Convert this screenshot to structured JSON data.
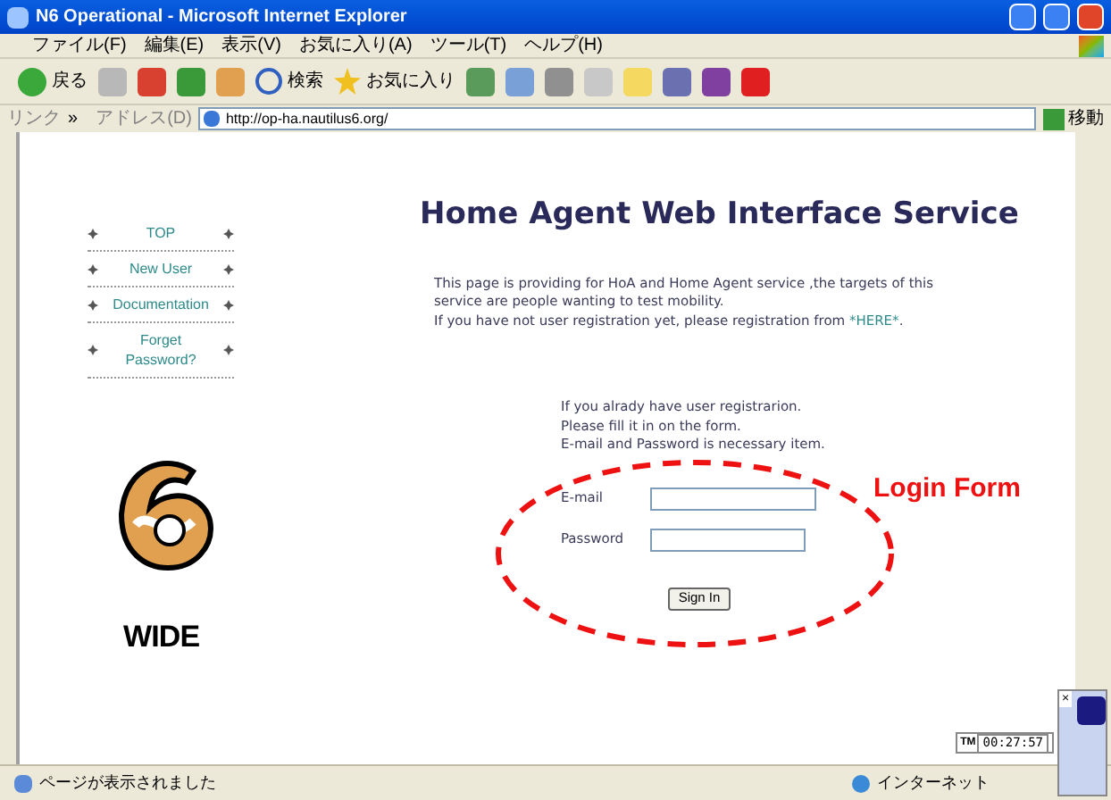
{
  "window": {
    "title": "N6 Operational - Microsoft Internet Explorer"
  },
  "menu": [
    "ファイル(F)",
    "編集(E)",
    "表示(V)",
    "お気に入り(A)",
    "ツール(T)",
    "ヘルプ(H)"
  ],
  "toolbar": {
    "back": "戻る",
    "search": "検索",
    "favorites": "お気に入り"
  },
  "address_bar": {
    "links": "リンク",
    "chevron": "»",
    "label": "アドレス(D)",
    "url": "http://op-ha.nautilus6.org/",
    "go": "移動"
  },
  "nav": [
    {
      "label": "TOP"
    },
    {
      "label": "New User"
    },
    {
      "label": "Documentation"
    },
    {
      "label": "Forget Password?"
    }
  ],
  "logo": {
    "wordmark": "WIDE"
  },
  "heading": "Home Agent Web Interface Service",
  "intro": {
    "lines": [
      "This page is providing for HoA and Home Agent service ,the targets of this",
      "service are people wanting to test mobility."
    ],
    "last_line": "If you have not user registration yet, please registration from ",
    "link": "*HERE*",
    "end": "."
  },
  "form": {
    "notes": [
      "If you alrady have user registrarion.",
      "Please fill it in on the form.",
      "E-mail and Password is necessary item."
    ],
    "fields": [
      {
        "label": "E-mail"
      },
      {
        "label": "Password"
      }
    ],
    "button": "Sign In"
  },
  "annotation": "Login Form",
  "status_bar": {
    "text": "ページが表示されました",
    "zone": "インターネット"
  },
  "widget": {
    "close": "×",
    "label": "TM",
    "time": "00:27:57"
  }
}
